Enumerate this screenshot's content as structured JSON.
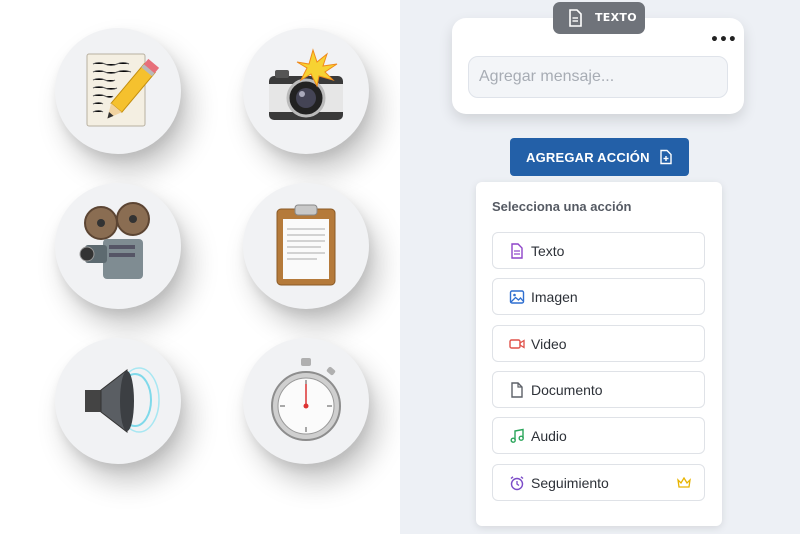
{
  "gallery": {
    "icons": [
      "handwritten-note-pencil-icon",
      "camera-flash-icon",
      "film-projector-icon",
      "clipboard-icon",
      "speaker-icon",
      "stopwatch-icon"
    ]
  },
  "message_card": {
    "pill_label": "TEXTO",
    "menu_glyph": "•••",
    "input_placeholder": "Agregar mensaje..."
  },
  "add_action_button": {
    "label": "AGREGAR ACCIÓN"
  },
  "action_panel": {
    "title": "Selecciona una acción",
    "options": [
      {
        "label": "Texto",
        "icon": "file-text-icon",
        "color": "#8e44c9"
      },
      {
        "label": "Imagen",
        "icon": "image-icon",
        "color": "#2f6fd0"
      },
      {
        "label": "Video",
        "icon": "video-icon",
        "color": "#e0524a"
      },
      {
        "label": "Documento",
        "icon": "document-icon",
        "color": "#5d6168"
      },
      {
        "label": "Audio",
        "icon": "music-note-icon",
        "color": "#2aa55a"
      },
      {
        "label": "Seguimiento",
        "icon": "alarm-clock-icon",
        "color": "#7b4bc8",
        "badge": "crown-icon"
      }
    ]
  },
  "colors": {
    "accent": "#2360a8",
    "pill": "#6f737a",
    "crown": "#e8b400"
  }
}
